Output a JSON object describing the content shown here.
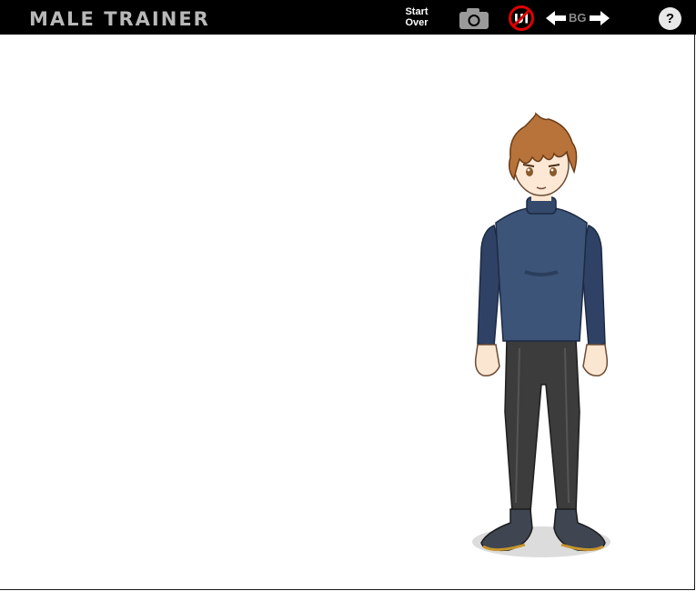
{
  "app": {
    "title": "Male Trainer"
  },
  "toolbar": {
    "start_over_line1": "Start",
    "start_over_line2": "Over",
    "camera_icon": "camera-icon",
    "ui_toggle_icon": "ui-hide-icon",
    "bg_label": "BG",
    "help_label": "?"
  },
  "colors": {
    "topbar": "#000000",
    "title": "#b9b9b9",
    "toggle_red": "#e00000",
    "shirt": "#3c5478",
    "pants": "#3a3a3a",
    "hair": "#b8733a"
  }
}
